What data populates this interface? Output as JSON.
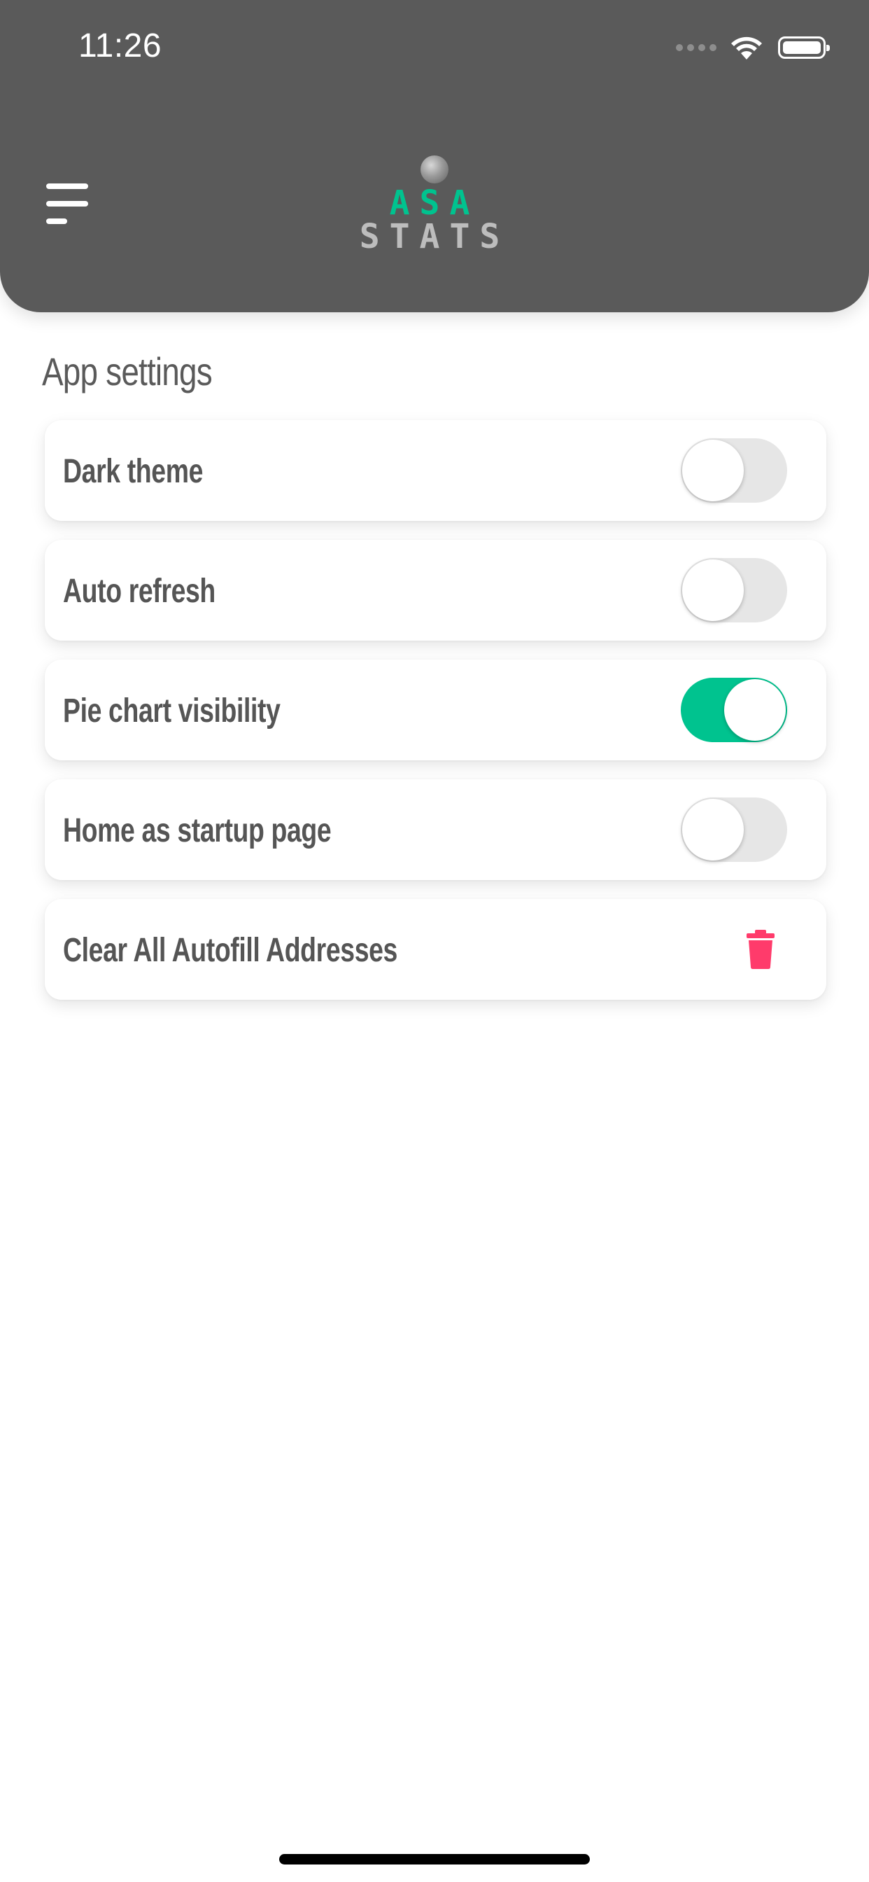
{
  "status_bar": {
    "time": "11:26",
    "icons": [
      "signal-dots-icon",
      "wifi-icon",
      "battery-icon"
    ]
  },
  "header": {
    "menu_icon": "menu-icon",
    "logo": {
      "line1": "ASA",
      "line2": "STATS"
    },
    "colors": {
      "background": "#5a5a5a",
      "accent": "#00c38f",
      "logo_secondary": "#bdbdbd"
    }
  },
  "section": {
    "title": "App settings"
  },
  "settings": [
    {
      "label": "Dark theme",
      "control": "toggle",
      "enabled": false
    },
    {
      "label": "Auto refresh",
      "control": "toggle",
      "enabled": false
    },
    {
      "label": "Pie chart visibility",
      "control": "toggle",
      "enabled": true
    },
    {
      "label": "Home as startup page",
      "control": "toggle",
      "enabled": false
    },
    {
      "label": "Clear All Autofill Addresses",
      "control": "trash-icon",
      "color": "#ff3b6b"
    }
  ]
}
